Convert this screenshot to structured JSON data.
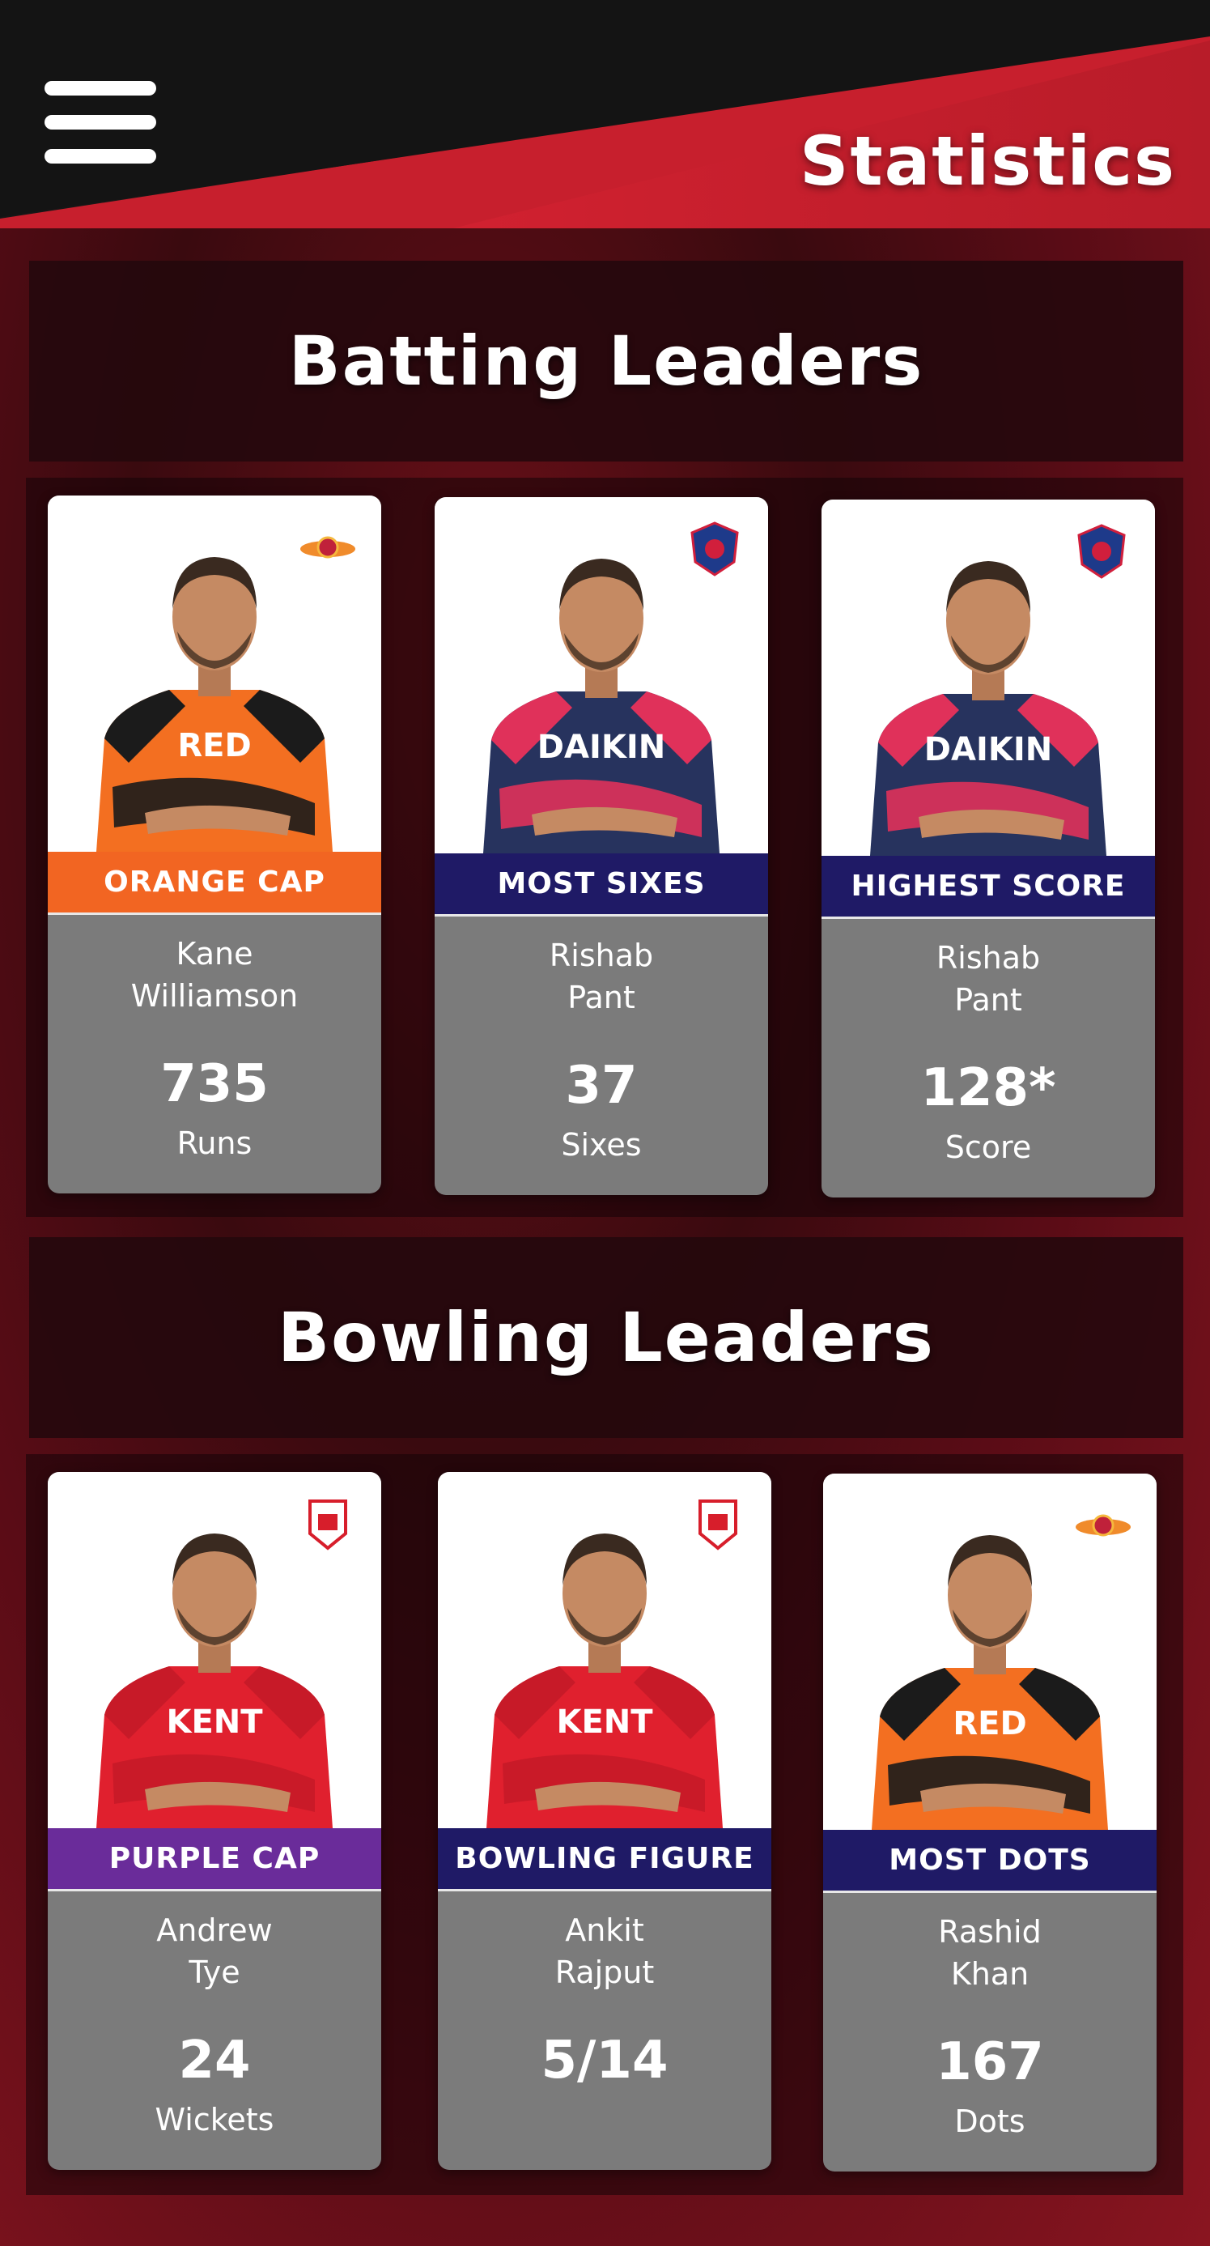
{
  "header": {
    "title": "Statistics",
    "menu_icon": "hamburger-menu-icon"
  },
  "batting": {
    "title": "Batting Leaders",
    "cards": [
      {
        "category": "ORANGE CAP",
        "category_color": "#f26522",
        "name": "Kane\nWilliamson",
        "value": "735",
        "unit": "Runs",
        "team_logo": "sunrisers-logo-icon",
        "jersey": "#f36f21",
        "jersey_shoulder": "#1b1b1b",
        "jersey_text": "RED"
      },
      {
        "category": "MOST SIXES",
        "category_color": "#1f1a66",
        "name": "Rishab\nPant",
        "value": "37",
        "unit": "Sixes",
        "team_logo": "delhi-capitals-logo-icon",
        "jersey": "#27335e",
        "jersey_shoulder": "#e0315a",
        "jersey_text": "DAIKIN"
      },
      {
        "category": "HIGHEST SCORE",
        "category_color": "#1f1a66",
        "name": "Rishab\nPant",
        "value": "128*",
        "unit": "Score",
        "team_logo": "delhi-capitals-logo-icon",
        "jersey": "#27335e",
        "jersey_shoulder": "#e0315a",
        "jersey_text": "DAIKIN"
      }
    ]
  },
  "bowling": {
    "title": "Bowling Leaders",
    "cards": [
      {
        "category": "PURPLE CAP",
        "category_color": "#6a2c9a",
        "name": "Andrew\nTye",
        "value": "24",
        "unit": "Wickets",
        "team_logo": "kings-xi-logo-icon",
        "jersey": "#e0202e",
        "jersey_shoulder": "#c71a28",
        "jersey_text": "KENT"
      },
      {
        "category": "BOWLING FIGURE",
        "category_color": "#1f1a66",
        "name": "Ankit\nRajput",
        "value": "5/14",
        "unit": "",
        "team_logo": "kings-xi-logo-icon",
        "jersey": "#e0202e",
        "jersey_shoulder": "#c71a28",
        "jersey_text": "KENT"
      },
      {
        "category": "MOST DOTS",
        "category_color": "#1f1a66",
        "name": "Rashid\nKhan",
        "value": "167",
        "unit": "Dots",
        "team_logo": "sunrisers-logo-icon",
        "jersey": "#f36f21",
        "jersey_shoulder": "#1b1b1b",
        "jersey_text": "RED"
      }
    ]
  }
}
